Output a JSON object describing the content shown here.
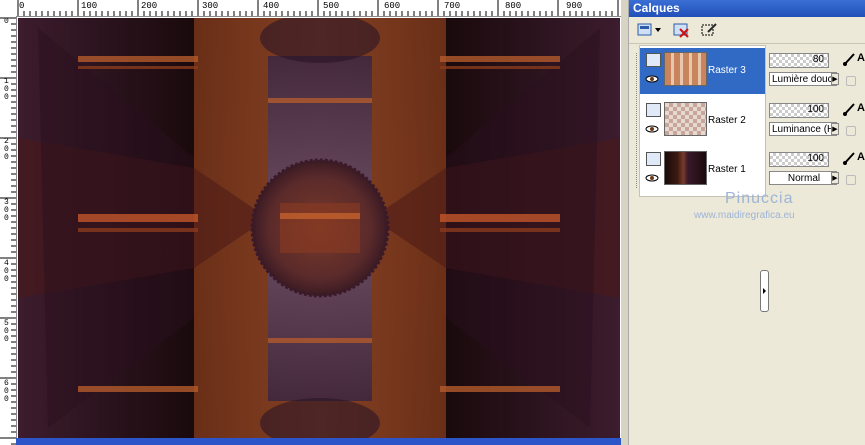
{
  "rulers": {
    "top_marks": [
      "0",
      "100",
      "200",
      "300",
      "400",
      "500",
      "600",
      "700",
      "800",
      "900"
    ],
    "left_marks": [
      "0",
      "100",
      "200",
      "300",
      "400",
      "500",
      "600"
    ]
  },
  "panel": {
    "title": "Calques",
    "toolbar_icons": [
      "new-layer-icon",
      "delete-layer-icon",
      "layer-properties-icon"
    ],
    "layers": [
      {
        "name": "Raster 3",
        "opacity": "80",
        "blend": "Lumière douce",
        "selected": true
      },
      {
        "name": "Raster 2",
        "opacity": "100",
        "blend": "Luminance (H)",
        "selected": false
      },
      {
        "name": "Raster 1",
        "opacity": "100",
        "blend": "Normal",
        "selected": false
      }
    ],
    "lock_letter": "A"
  },
  "watermark": {
    "name": "Pinuccia",
    "url": "www.maidiregrafica.eu"
  }
}
